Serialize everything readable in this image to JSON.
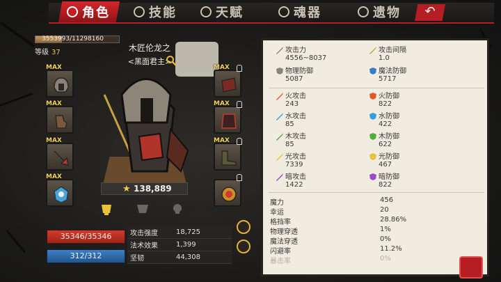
{
  "tabs": [
    {
      "label": "角色",
      "active": true
    },
    {
      "label": "技能",
      "active": false
    },
    {
      "label": "天赋",
      "active": false
    },
    {
      "label": "魂器",
      "active": false
    },
    {
      "label": "遗物",
      "active": false
    }
  ],
  "back_icon": "back-arrow-icon",
  "experience": {
    "text": "3553993/11298160",
    "fraction": 0.315
  },
  "level": {
    "label": "等级",
    "value": "37"
  },
  "character": {
    "name": "木匠伦龙之",
    "title": "<黑面君主>"
  },
  "power": {
    "value": "138,889"
  },
  "equipment": {
    "left": [
      "helmet-icon",
      "gloves-icon",
      "weapon-icon",
      "accessory-icon"
    ],
    "right": [
      "bracer-icon",
      "armor-icon",
      "boots-icon",
      "amulet-icon"
    ],
    "max_label": "MAX"
  },
  "bars": {
    "hp": "35346/35346",
    "mp": "312/312"
  },
  "mini_stats": [
    {
      "label": "攻击强度",
      "value": "18,725"
    },
    {
      "label": "法术效果",
      "value": "1,399"
    },
    {
      "label": "坚韧",
      "value": "44,308"
    }
  ],
  "primary_stats": [
    {
      "label": "攻击力",
      "value": "4556~8037",
      "icon": "sword-icon"
    },
    {
      "label": "攻击间隔",
      "value": "1.0",
      "icon": "speed-icon"
    },
    {
      "label": "物理防御",
      "value": "5087",
      "icon": "shield-icon"
    },
    {
      "label": "魔法防御",
      "value": "5717",
      "icon": "magic-shield-icon"
    }
  ],
  "elements": [
    {
      "atk_label": "火攻击",
      "atk": "243",
      "def_label": "火防御",
      "def": "822",
      "color": "#e8542a"
    },
    {
      "atk_label": "水攻击",
      "atk": "85",
      "def_label": "水防御",
      "def": "422",
      "color": "#3a9be0"
    },
    {
      "atk_label": "木攻击",
      "atk": "85",
      "def_label": "木防御",
      "def": "622",
      "color": "#4fae3a"
    },
    {
      "atk_label": "光攻击",
      "atk": "7339",
      "def_label": "光防御",
      "def": "467",
      "color": "#e8c23a"
    },
    {
      "atk_label": "暗攻击",
      "atk": "1422",
      "def_label": "暗防御",
      "def": "822",
      "color": "#9a48c8"
    }
  ],
  "secondary_stats": [
    {
      "label": "魔力",
      "value": "456",
      "dim": false
    },
    {
      "label": "幸运",
      "value": "20",
      "dim": false
    },
    {
      "label": "格挡率",
      "value": "28.86%",
      "dim": false
    },
    {
      "label": "物理穿透",
      "value": "1%",
      "dim": false
    },
    {
      "label": "魔法穿透",
      "value": "0%",
      "dim": false
    },
    {
      "label": "闪避率",
      "value": "11.2%",
      "dim": false
    },
    {
      "label": "暴击率",
      "value": "0%",
      "dim": true
    }
  ]
}
